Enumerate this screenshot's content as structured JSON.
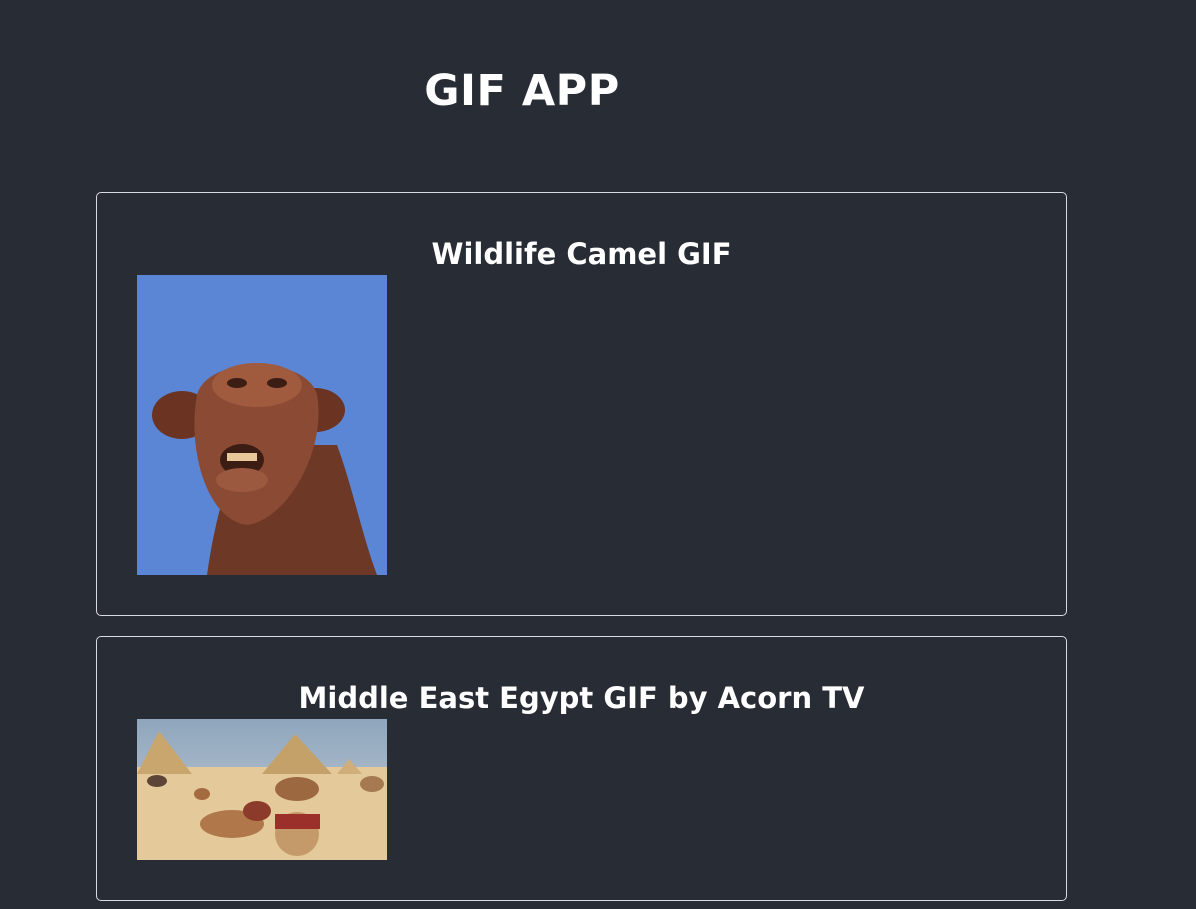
{
  "app": {
    "title": "GIF APP"
  },
  "gifs": [
    {
      "title": "Wildlife Camel GIF",
      "image_subject": "camel close-up against blue sky",
      "colors": {
        "sky": "#5b86d6",
        "fur": "#7a3f2c"
      }
    },
    {
      "title": "Middle East Egypt GIF by Acorn TV",
      "image_subject": "camels resting in front of the pyramids",
      "colors": {
        "sky": "#a9b9c9",
        "sand": "#e4c99a"
      }
    }
  ]
}
